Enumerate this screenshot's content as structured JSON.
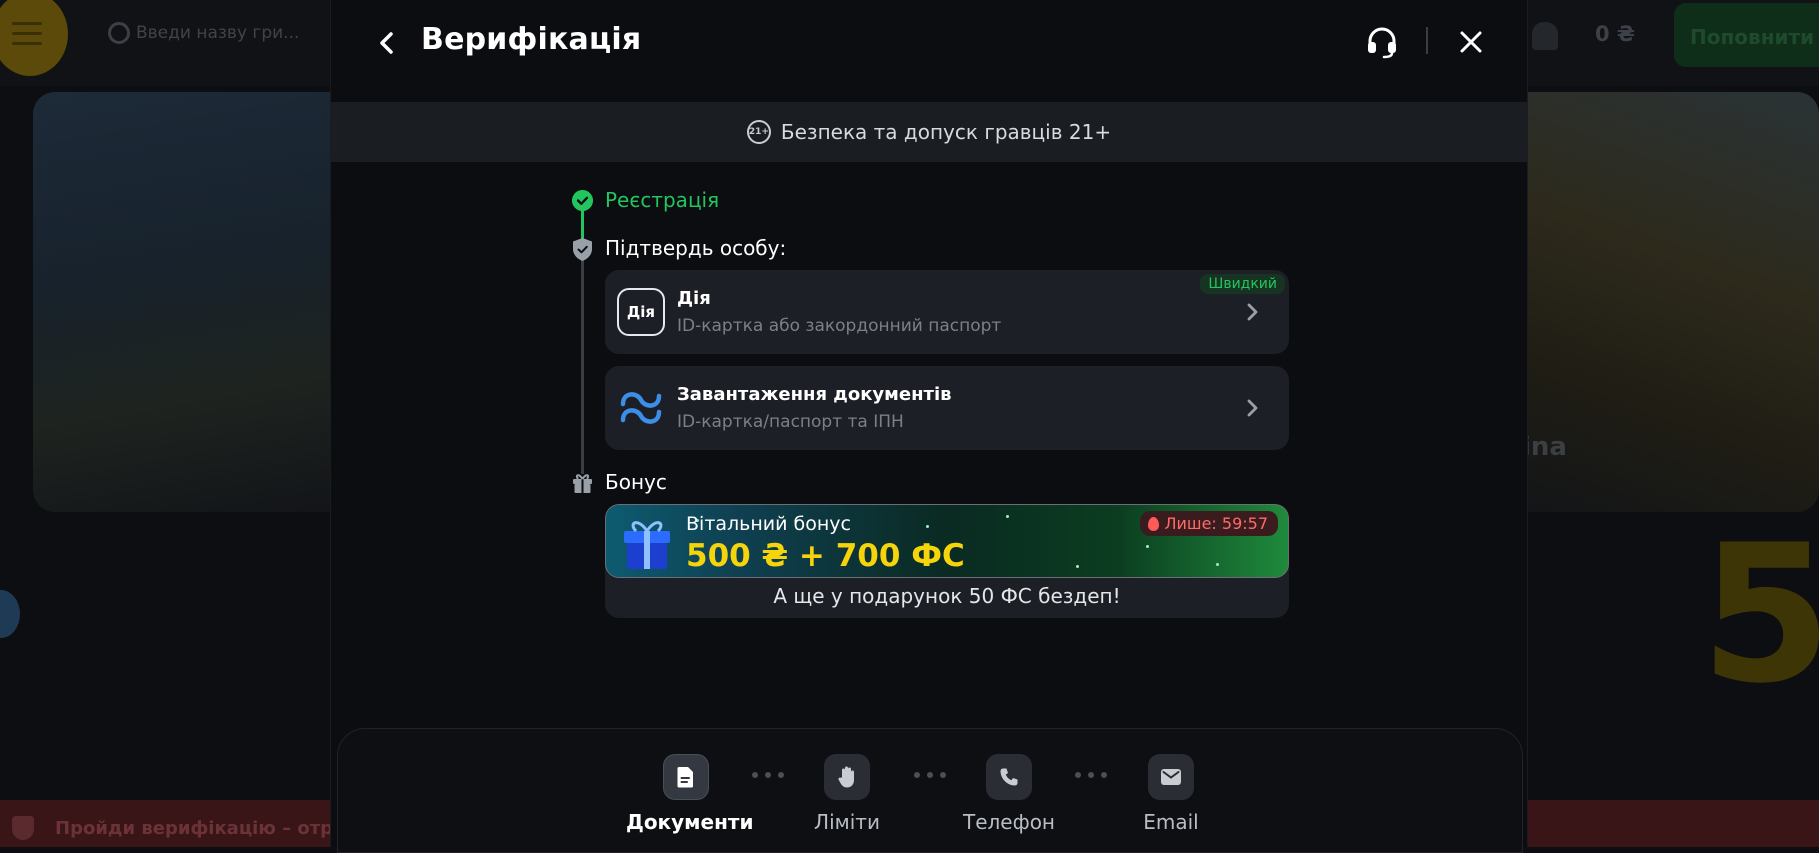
{
  "background": {
    "search_placeholder": "Введи назву гри...",
    "balance": "0 ₴",
    "topup_label": "Поповнити",
    "side_text": "ina",
    "big_digit": "5",
    "verify_banner": "Пройди верифікацію – отр"
  },
  "modal": {
    "title": "Верифікація",
    "safety_banner": {
      "icon": "21+",
      "text": "Безпека та допуск гравців 21+"
    },
    "steps": {
      "registration": "Реєстрація",
      "confirm": "Підтвердь особу:",
      "bonus": "Бонус"
    },
    "options": [
      {
        "logo": "Дія",
        "title": "Дія",
        "subtitle": "ID-картка або закордонний паспорт",
        "badge": "Швидкий"
      },
      {
        "title": "Завантаження документів",
        "subtitle": "ID-картка/паспорт та ІПН"
      }
    ],
    "bonus_card": {
      "label": "Вітальний бонус",
      "amount": "500 ₴ + 700 ФС",
      "timer": "Лише: 59:57",
      "extra": "А ще у подарунок 50 ФС бездеп!"
    },
    "nav": [
      {
        "label": "Документи",
        "icon": "document-icon",
        "active": true
      },
      {
        "label": "Ліміти",
        "icon": "hand-icon",
        "active": false
      },
      {
        "label": "Телефон",
        "icon": "phone-icon",
        "active": false
      },
      {
        "label": "Email",
        "icon": "email-icon",
        "active": false
      }
    ]
  },
  "colors": {
    "accent_green": "#22c55e",
    "bonus_yellow": "#f6d40b",
    "timer_red": "#ff6b6b"
  }
}
